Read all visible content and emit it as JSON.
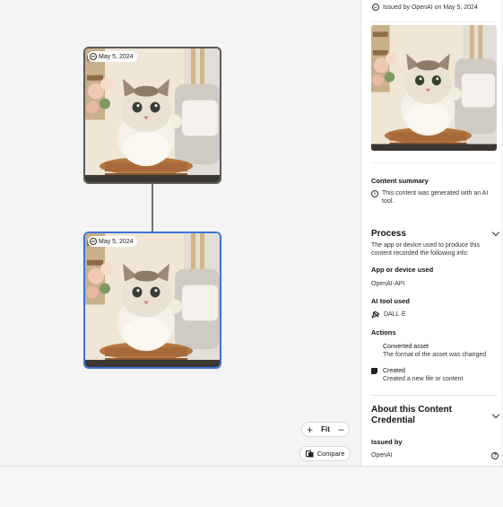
{
  "canvas": {
    "nodes": [
      {
        "date": "May 5, 2024"
      },
      {
        "date": "May 5, 2024"
      }
    ],
    "zoom": {
      "plus": "+",
      "fit": "Fit",
      "minus": "−"
    },
    "compare_label": "Compare"
  },
  "panel": {
    "issued_line": "Issued by OpenAI on May 5, 2024",
    "content_summary": {
      "title": "Content summary",
      "text": "This content was generated with an AI tool."
    },
    "process": {
      "title": "Process",
      "description": "The app or device used to produce this content recorded the following info:",
      "app_label": "App or device used",
      "app_value": "OpenAI-API",
      "ai_tool_label": "AI tool used",
      "ai_tool_value": "DALL·E",
      "actions_label": "Actions",
      "actions": [
        {
          "title": "Converted asset",
          "desc": "The format of the asset was changed"
        },
        {
          "title": "Created",
          "desc": "Created a new file or content"
        }
      ]
    },
    "about": {
      "title": "About this Content Credential",
      "issued_by_label": "Issued by",
      "issued_by_value": "OpenAI"
    }
  },
  "colors": {
    "selected_border": "#3b74d9",
    "node_border": "#5a5a5a",
    "connector": "#6e6e6e"
  }
}
